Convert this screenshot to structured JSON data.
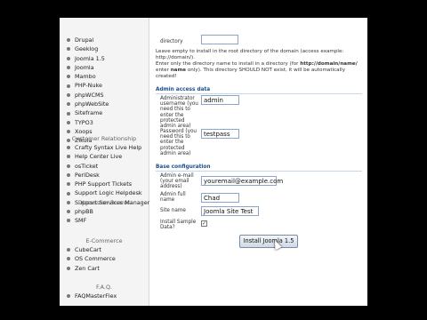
{
  "sidebar": {
    "cms": [
      "Drupal",
      "Geeklog",
      "Joomla 1.5",
      "Joomla",
      "Mambo",
      "PHP-Nuke",
      "phpWCMS",
      "phpWebSite",
      "Siteframe",
      "TYPO3",
      "Xoops",
      "Zikula"
    ],
    "crm_heading": "Customer Relationship",
    "crm": [
      "Crafty Syntax Live Help",
      "Help Center Live",
      "osTicket",
      "PerlDesk",
      "PHP Support Tickets",
      "Support Logic Helpdesk",
      "Support Services Manager"
    ],
    "boards_heading": "Discussion Boards",
    "boards": [
      "phpBB",
      "SMF"
    ],
    "ecommerce_heading": "E-Commerce",
    "ecommerce": [
      "CubeCart",
      "OS Commerce",
      "Zen Cart"
    ],
    "faq_heading": "F.A.Q.",
    "faq": [
      "FAQMasterFlex"
    ]
  },
  "form": {
    "directory_label": "directory",
    "directory_help_1": "Leave empty to install in the root directory of the domain (access example: http://domain/).",
    "directory_help_2a": "Enter only the directory name to install in a directory (for ",
    "directory_help_2b": "http://domain/name/",
    "directory_help_2c": " enter ",
    "directory_help_2d": "name",
    "directory_help_2e": " only). This directory SHOULD NOT exist, it will be automatically created!",
    "admin_section": "Admin access data",
    "admin_user_label": "Administrator username (you need this to enter the protected admin area)",
    "admin_user_value": "admin",
    "admin_pass_label": "Password (you need this to enter the protected admin area)",
    "admin_pass_value": "testpass",
    "base_section": "Base configuration",
    "email_label": "Admin e-mail (your email address)",
    "email_value": "youremail@example.com",
    "fullname_label": "Admin full name",
    "fullname_value": "Chad",
    "sitename_label": "Site name",
    "sitename_value": "Joomla Site Test",
    "sample_label": "Install Sample Data?",
    "sample_checked": "✓",
    "install_button": "Install Joomla 1.5"
  }
}
